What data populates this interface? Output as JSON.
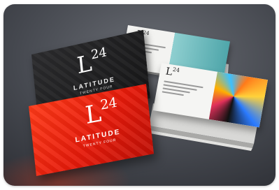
{
  "photo": {
    "subject": "business-card-mockup",
    "colors": {
      "background": "#4a4d55",
      "red_card": "#ef2a12",
      "black_card": "#1d1d1f",
      "teal_accent": "#5fb3b5"
    }
  },
  "cards": {
    "red": {
      "monogram": "L",
      "superscript": "24",
      "word": "LATITUDE",
      "sub": "TWENTY FOUR"
    },
    "black": {
      "monogram": "L",
      "superscript": "24",
      "word": "LATITUDE",
      "sub": "TWENTY FOUR"
    },
    "teal": {
      "monogram": "L",
      "superscript": "24"
    },
    "art": {
      "monogram": "L",
      "superscript": "24"
    }
  }
}
